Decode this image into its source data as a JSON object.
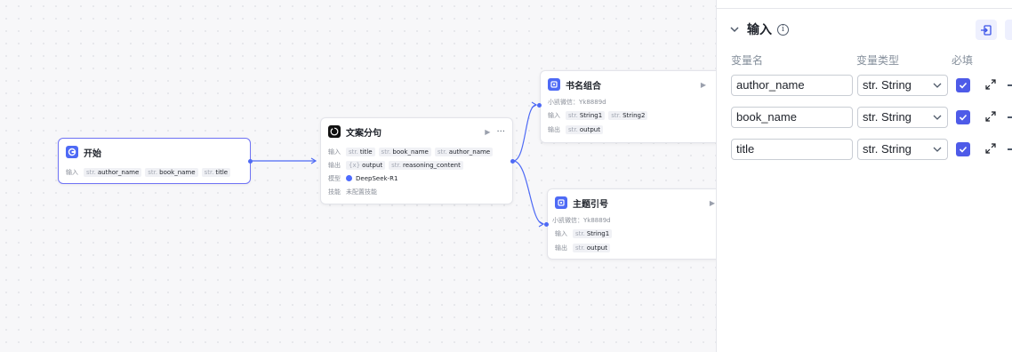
{
  "canvas": {
    "start_node": {
      "title": "开始",
      "input_label": "输入",
      "inputs": [
        {
          "type": "str.",
          "name": "author_name"
        },
        {
          "type": "str.",
          "name": "book_name"
        },
        {
          "type": "str.",
          "name": "title"
        }
      ]
    },
    "copy_node": {
      "title": "文案分句",
      "input_label": "输入",
      "inputs": [
        {
          "type": "str.",
          "name": "title"
        },
        {
          "type": "str.",
          "name": "book_name"
        },
        {
          "type": "str.",
          "name": "author_name"
        }
      ],
      "output_label": "输出",
      "outputs": [
        {
          "type": "{x}",
          "name": "output"
        },
        {
          "type": "str.",
          "name": "reasoning_content"
        }
      ],
      "model_label": "模型",
      "model": "DeepSeek-R1",
      "skill_label": "技能",
      "skill_value": "未配置技能"
    },
    "bookname_node": {
      "title": "书名组合",
      "author_line": "小凯微信：Yk8889d",
      "input_label": "输入",
      "inputs": [
        {
          "type": "str.",
          "name": "String1"
        },
        {
          "type": "str.",
          "name": "String2"
        }
      ],
      "output_label": "输出",
      "outputs": [
        {
          "type": "str.",
          "name": "output"
        }
      ]
    },
    "theme_node": {
      "title": "主题引号",
      "author_line": "小凯微信：Yk8889d",
      "input_label": "输入",
      "inputs": [
        {
          "type": "str.",
          "name": "String1"
        }
      ],
      "output_label": "输出",
      "outputs": [
        {
          "type": "str.",
          "name": "output"
        }
      ]
    }
  },
  "panel": {
    "section_title": "输入",
    "columns": {
      "name": "变量名",
      "type": "变量类型",
      "required": "必填"
    },
    "variables": [
      {
        "name": "author_name",
        "type": "str. String",
        "required": true
      },
      {
        "name": "book_name",
        "type": "str. String",
        "required": true
      },
      {
        "name": "title",
        "type": "str. String",
        "required": true
      }
    ]
  },
  "colors": {
    "accent": "#4e6af5",
    "checkbox": "#4e5be8",
    "edge": "#4e6af5"
  }
}
